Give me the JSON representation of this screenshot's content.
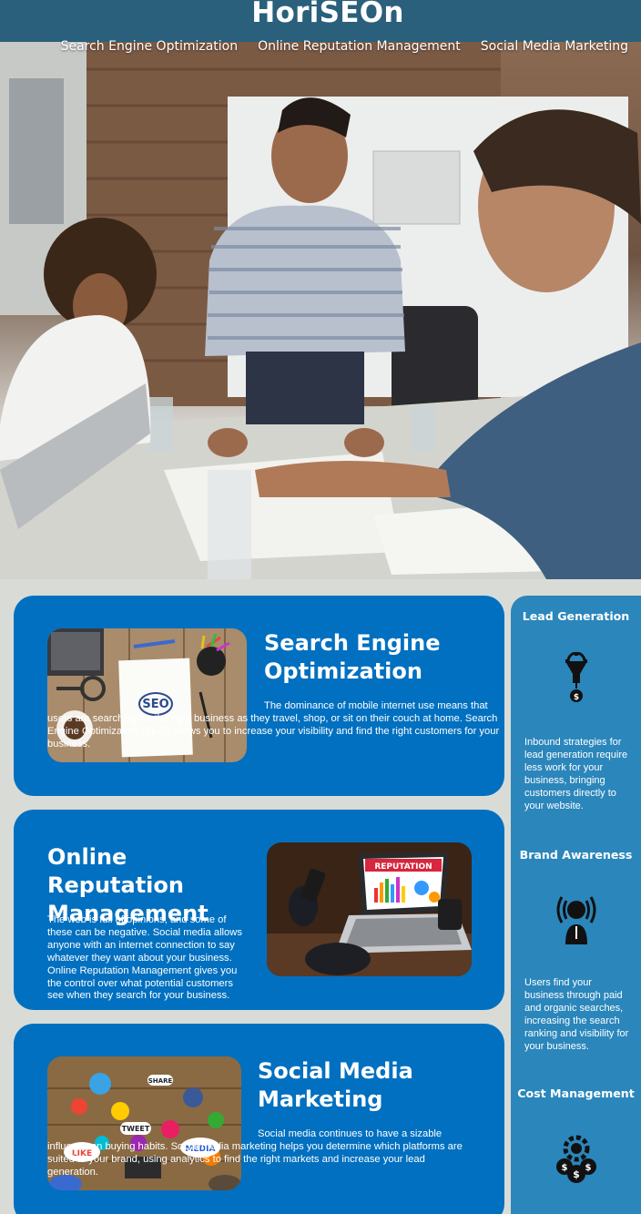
{
  "header": {
    "logo": "HoriSEOn",
    "nav": [
      "Search Engine Optimization",
      "Online Reputation Management",
      "Social Media Marketing"
    ]
  },
  "content": [
    {
      "title": "Search Engine Optimization",
      "body": "The dominance of mobile internet use means that users are searching for the right business as they travel, shop, or sit on their couch at home. Search Engine Optimization (SEO) allows you to increase your visibility and find the right customers for your business.",
      "image_label": "SEO"
    },
    {
      "title": "Online Reputation Management",
      "body": "The web is full of opinions, and some of these can be negative. Social media allows anyone with an internet connection to say whatever they want about your business. Online Reputation Management gives you the control over what potential customers see when they search for your business.",
      "image_label": "REPUTATION"
    },
    {
      "title": "Social Media Marketing",
      "body": "Social media continues to have a sizable influence on buying habits. Social media marketing helps you determine which platforms are suited to your brand, using analytics to find the right markets and increase your lead generation.",
      "image_labels": [
        "SHARE",
        "TWEET",
        "LIKE",
        "MEDIA"
      ]
    }
  ],
  "benefits": [
    {
      "title": "Lead Generation",
      "icon": "lead-funnel-icon",
      "body": "Inbound strategies for lead generation require less work for your business, bringing customers directly to your website."
    },
    {
      "title": "Brand Awareness",
      "icon": "brand-broadcast-icon",
      "body": "Users find your business through paid and organic searches, increasing the search ranking and visibility for your business."
    },
    {
      "title": "Cost Management",
      "icon": "cost-gears-icon",
      "body": ""
    }
  ],
  "colors": {
    "header_bg": "#2a607c",
    "card_bg": "#0170c0",
    "sidebar_bg": "#2b86bb",
    "page_bg": "#d9dcd6"
  }
}
